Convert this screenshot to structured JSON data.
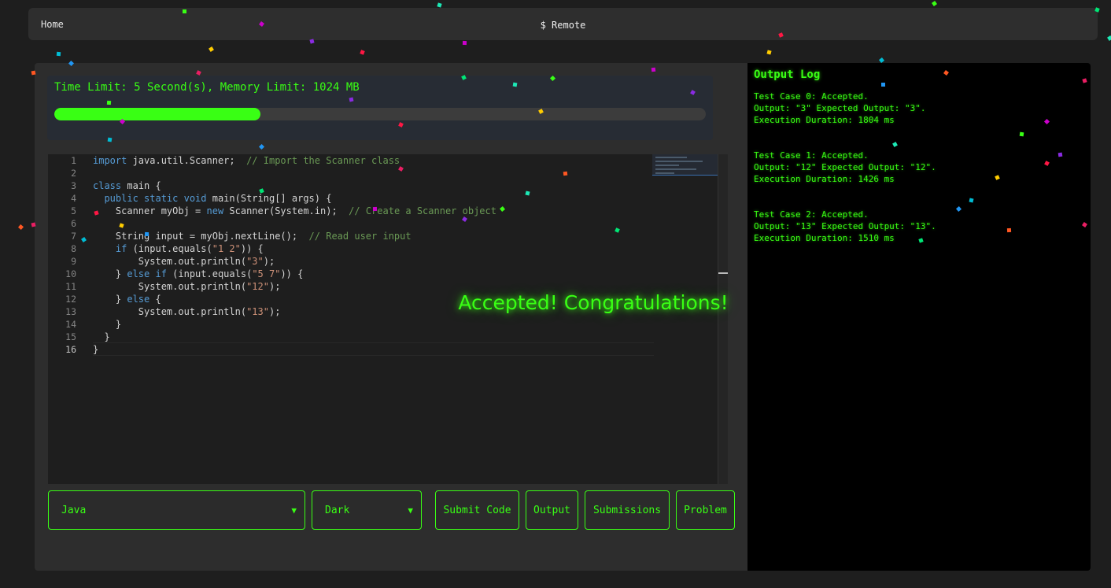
{
  "nav": {
    "home": "Home",
    "brand": "$ Remote"
  },
  "limits": {
    "text": "Time Limit: 5 Second(s), Memory Limit: 1024 MB",
    "progress_percent": 31.6,
    "progress_color": "#39ff14"
  },
  "editor": {
    "line_numbers": [
      "1",
      "2",
      "3",
      "4",
      "5",
      "6",
      "7",
      "8",
      "9",
      "10",
      "11",
      "12",
      "13",
      "14",
      "15",
      "16"
    ],
    "current_line": "16",
    "lines": [
      [
        [
          "kw",
          "import"
        ],
        [
          "t",
          " java.util.Scanner;  "
        ],
        [
          "cm",
          "// Import the Scanner class"
        ]
      ],
      [],
      [
        [
          "kw",
          "class"
        ],
        [
          "t",
          " main {"
        ]
      ],
      [
        [
          "t",
          "  "
        ],
        [
          "kw",
          "public static void"
        ],
        [
          "t",
          " main(String[] args) {"
        ]
      ],
      [
        [
          "t",
          "    Scanner myObj = "
        ],
        [
          "kw",
          "new"
        ],
        [
          "t",
          " Scanner(System.in);  "
        ],
        [
          "cm",
          "// Create a Scanner object"
        ]
      ],
      [],
      [
        [
          "t",
          "    String input = myObj.nextLine();  "
        ],
        [
          "cm",
          "// Read user input"
        ]
      ],
      [
        [
          "t",
          "    "
        ],
        [
          "kw",
          "if"
        ],
        [
          "t",
          " (input.equals("
        ],
        [
          "st",
          "\"1 2\""
        ],
        [
          "t",
          ")) {"
        ]
      ],
      [
        [
          "t",
          "        System.out.println("
        ],
        [
          "st",
          "\"3\""
        ],
        [
          "t",
          ");"
        ]
      ],
      [
        [
          "t",
          "    } "
        ],
        [
          "kw",
          "else if"
        ],
        [
          "t",
          " (input.equals("
        ],
        [
          "st",
          "\"5 7\""
        ],
        [
          "t",
          ")) {"
        ]
      ],
      [
        [
          "t",
          "        System.out.println("
        ],
        [
          "st",
          "\"12\""
        ],
        [
          "t",
          ");"
        ]
      ],
      [
        [
          "t",
          "    } "
        ],
        [
          "kw",
          "else"
        ],
        [
          "t",
          " {"
        ]
      ],
      [
        [
          "t",
          "        System.out.println("
        ],
        [
          "st",
          "\"13\""
        ],
        [
          "t",
          ");"
        ]
      ],
      [
        [
          "t",
          "    }"
        ]
      ],
      [
        [
          "t",
          "  }"
        ]
      ],
      [
        [
          "t",
          "}"
        ]
      ]
    ]
  },
  "overlay": {
    "message": "Accepted! Congratulations!"
  },
  "controls": {
    "language": "Java",
    "theme": "Dark",
    "dropdown_arrow": "▼",
    "submit": "Submit Code",
    "output": "Output",
    "submissions": "Submissions",
    "problem": "Problem"
  },
  "output_log": {
    "title": "Output Log",
    "entries": [
      {
        "status": "Test Case 0: Accepted.",
        "detail": "Output: \"3\" Expected Output: \"3\".",
        "duration": "Execution Duration: 1804 ms"
      },
      {
        "status": "Test Case 1: Accepted.",
        "detail": "Output: \"12\" Expected Output: \"12\".",
        "duration": "Execution Duration: 1426 ms"
      },
      {
        "status": "Test Case 2: Accepted.",
        "detail": "Output: \"13\" Expected Output: \"13\".",
        "duration": "Execution Duration: 1510 ms"
      }
    ]
  },
  "colors": {
    "accent": "#39ff14",
    "background": "#1e1e1e",
    "panel": "#2d2d2d",
    "log_background": "#000000"
  },
  "confetti_colors": [
    "#39ff14",
    "#cc00cc",
    "#8a2be2",
    "#ff1744",
    "#ffcc00",
    "#00bcd4",
    "#2196f3",
    "#ff5722",
    "#e91e63",
    "#00e676",
    "#1de9b6"
  ]
}
